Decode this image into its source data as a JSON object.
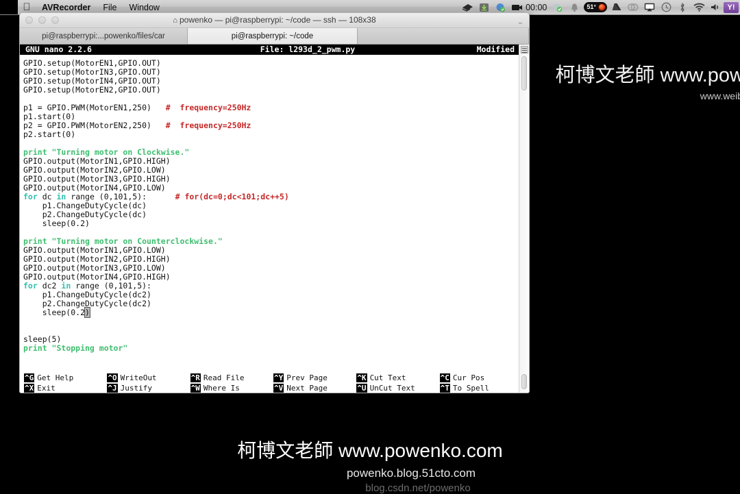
{
  "menubar": {
    "apple_icon": "apple-icon",
    "app_name": "AVRecorder",
    "menus": [
      "File",
      "Window"
    ],
    "clock": "00:00",
    "weather_temp": "51°",
    "yahoo_label": "Y!",
    "status_icons": [
      "dropbox-icon",
      "downloads-icon",
      "sync-check-icon",
      "camera-icon",
      "clock-time",
      "cloud-check-icon",
      "bell-icon",
      "weather-chip",
      "google-drive-icon",
      "creative-cloud-icon",
      "airplay-icon",
      "time-machine-icon",
      "bluetooth-icon",
      "wifi-icon",
      "volume-icon",
      "yahoo-icon"
    ]
  },
  "window": {
    "title": "powenko — pi@raspberrypi: ~/code — ssh — 108x38",
    "home_icon": "⌂",
    "tabs": [
      {
        "label": "pi@raspberrypi:...powenko/files/car",
        "active": false
      },
      {
        "label": "pi@raspberrypi: ~/code",
        "active": true
      }
    ]
  },
  "nano": {
    "version_label": "GNU nano 2.2.6",
    "file_label": "File: l293d_2_pwm.py",
    "status_label": "Modified",
    "help": [
      [
        {
          "key": "^G",
          "label": "Get Help"
        },
        {
          "key": "^X",
          "label": "Exit"
        }
      ],
      [
        {
          "key": "^O",
          "label": "WriteOut"
        },
        {
          "key": "^J",
          "label": "Justify"
        }
      ],
      [
        {
          "key": "^R",
          "label": "Read File"
        },
        {
          "key": "^W",
          "label": "Where Is"
        }
      ],
      [
        {
          "key": "^Y",
          "label": "Prev Page"
        },
        {
          "key": "^V",
          "label": "Next Page"
        }
      ],
      [
        {
          "key": "^K",
          "label": "Cut Text"
        },
        {
          "key": "^U",
          "label": "UnCut Text"
        }
      ],
      [
        {
          "key": "^C",
          "label": "Cur Pos"
        },
        {
          "key": "^T",
          "label": "To Spell"
        }
      ]
    ]
  },
  "code_lines": [
    [
      {
        "t": "plain",
        "s": "GPIO.setup(MotorEN1,GPIO.OUT)"
      }
    ],
    [
      {
        "t": "plain",
        "s": "GPIO.setup(MotorIN3,GPIO.OUT)"
      }
    ],
    [
      {
        "t": "plain",
        "s": "GPIO.setup(MotorIN4,GPIO.OUT)"
      }
    ],
    [
      {
        "t": "plain",
        "s": "GPIO.setup(MotorEN2,GPIO.OUT)"
      }
    ],
    [
      {
        "t": "plain",
        "s": ""
      }
    ],
    [
      {
        "t": "plain",
        "s": "p1 = GPIO.PWM(MotorEN1,250)   "
      },
      {
        "t": "comment",
        "s": "#  frequency=250Hz"
      }
    ],
    [
      {
        "t": "plain",
        "s": "p1.start(0)"
      }
    ],
    [
      {
        "t": "plain",
        "s": "p2 = GPIO.PWM(MotorEN2,250)   "
      },
      {
        "t": "comment",
        "s": "#  frequency=250Hz"
      }
    ],
    [
      {
        "t": "plain",
        "s": "p2.start(0)"
      }
    ],
    [
      {
        "t": "plain",
        "s": ""
      }
    ],
    [
      {
        "t": "print",
        "s": "print "
      },
      {
        "t": "string",
        "s": "\"Turning motor on Clockwise.\""
      }
    ],
    [
      {
        "t": "plain",
        "s": "GPIO.output(MotorIN1,GPIO.HIGH)"
      }
    ],
    [
      {
        "t": "plain",
        "s": "GPIO.output(MotorIN2,GPIO.LOW)"
      }
    ],
    [
      {
        "t": "plain",
        "s": "GPIO.output(MotorIN3,GPIO.HIGH)"
      }
    ],
    [
      {
        "t": "plain",
        "s": "GPIO.output(MotorIN4,GPIO.LOW)"
      }
    ],
    [
      {
        "t": "kw",
        "s": "for "
      },
      {
        "t": "plain",
        "s": "dc "
      },
      {
        "t": "kw",
        "s": "in "
      },
      {
        "t": "plain",
        "s": "range (0,101,5):      "
      },
      {
        "t": "comment",
        "s": "# for(dc=0;dc<101;dc++5)"
      }
    ],
    [
      {
        "t": "plain",
        "s": "    p1.ChangeDutyCycle(dc)"
      }
    ],
    [
      {
        "t": "plain",
        "s": "    p2.ChangeDutyCycle(dc)"
      }
    ],
    [
      {
        "t": "plain",
        "s": "    sleep(0.2)"
      }
    ],
    [
      {
        "t": "plain",
        "s": ""
      }
    ],
    [
      {
        "t": "print",
        "s": "print "
      },
      {
        "t": "string",
        "s": "\"Turning motor on Counterclockwise.\""
      }
    ],
    [
      {
        "t": "plain",
        "s": "GPIO.output(MotorIN1,GPIO.LOW)"
      }
    ],
    [
      {
        "t": "plain",
        "s": "GPIO.output(MotorIN2,GPIO.HIGH)"
      }
    ],
    [
      {
        "t": "plain",
        "s": "GPIO.output(MotorIN3,GPIO.LOW)"
      }
    ],
    [
      {
        "t": "plain",
        "s": "GPIO.output(MotorIN4,GPIO.HIGH)"
      }
    ],
    [
      {
        "t": "kw",
        "s": "for "
      },
      {
        "t": "plain",
        "s": "dc2 "
      },
      {
        "t": "kw",
        "s": "in "
      },
      {
        "t": "plain",
        "s": "range (0,101,5):"
      }
    ],
    [
      {
        "t": "plain",
        "s": "    p1.ChangeDutyCycle(dc2)"
      }
    ],
    [
      {
        "t": "plain",
        "s": "    p2.ChangeDutyCycle(dc2)"
      }
    ],
    [
      {
        "t": "plain",
        "s": "    sleep(0.2"
      },
      {
        "t": "cursor",
        "s": ")"
      }
    ],
    [
      {
        "t": "plain",
        "s": ""
      }
    ],
    [
      {
        "t": "plain",
        "s": ""
      }
    ],
    [
      {
        "t": "plain",
        "s": "sleep(5)"
      }
    ],
    [
      {
        "t": "print",
        "s": "print "
      },
      {
        "t": "string",
        "s": "\"Stopping motor\""
      }
    ]
  ],
  "watermark_top": {
    "line1": "柯博文老師 www.pow",
    "line2": "www.weib"
  },
  "watermark_bottom": {
    "line1": "柯博文老師 www.powenko.com",
    "line2": "powenko.blog.51cto.com",
    "line3": "blog.csdn.net/powenko"
  }
}
